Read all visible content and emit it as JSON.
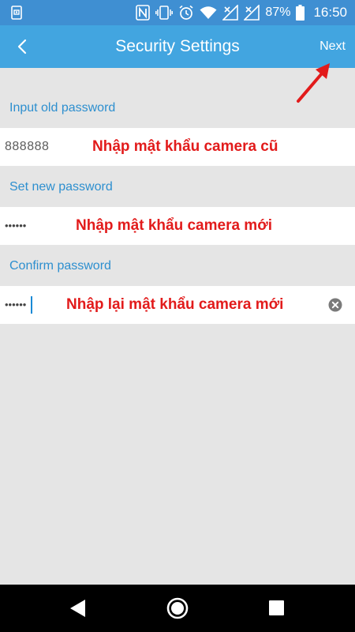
{
  "status_bar": {
    "battery_percent": "87%",
    "time": "16:50",
    "icons": [
      "screenshot-icon",
      "nfc-icon",
      "vibrate-icon",
      "alarm-icon",
      "wifi-icon",
      "signal-no-data-icon",
      "signal-no-data-icon",
      "battery-icon"
    ]
  },
  "app_bar": {
    "title": "Security Settings",
    "next_label": "Next",
    "back_icon": "chevron-left-icon"
  },
  "form": {
    "old_password": {
      "label": "Input old password",
      "value": "888888",
      "annotation": "Nhập mật khẩu camera cũ"
    },
    "new_password": {
      "label": "Set new password",
      "value": "••••••",
      "annotation": "Nhập mật khẩu camera mới"
    },
    "confirm_password": {
      "label": "Confirm password",
      "value": "••••••",
      "annotation": "Nhập lại mật khẩu camera mới",
      "clear_icon": "clear-icon"
    }
  },
  "colors": {
    "status_bar": "#3f8fd2",
    "app_bar": "#42a5e0",
    "label_text": "#2d8fcf",
    "annotation": "#e21b1b",
    "background": "#e5e5e5"
  },
  "nav_bar": {
    "icons": [
      "back-triangle-icon",
      "home-circle-icon",
      "recents-square-icon"
    ]
  }
}
